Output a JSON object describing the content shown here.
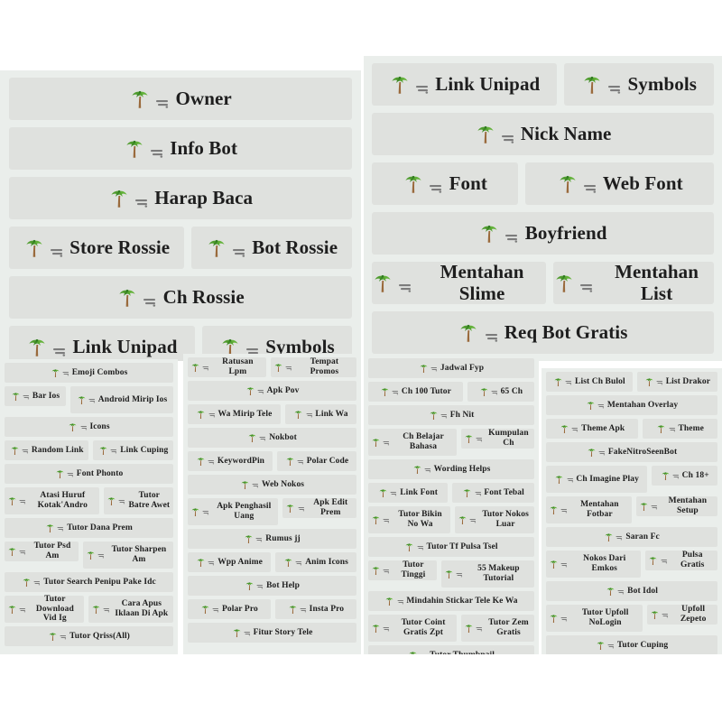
{
  "meta": {
    "icon_name": "palm-tree-icon",
    "panel_bg": "#eaeeeb",
    "button_bg": "#dfe1de",
    "text_color": "#1e1e1e",
    "page_bg": "#ffffff"
  },
  "panels": [
    {
      "id": "panel-top-left",
      "rows": [
        [
          "Owner"
        ],
        [
          "Info Bot"
        ],
        [
          "Harap Baca"
        ],
        [
          "Store Rossie",
          "Bot Rossie"
        ],
        [
          "Ch Rossie"
        ],
        [
          "Link Unipad",
          "Symbols"
        ]
      ]
    },
    {
      "id": "panel-top-right",
      "rows": [
        [
          "Link Unipad",
          "Symbols"
        ],
        [
          "Nick Name"
        ],
        [
          "Font",
          "Web Font"
        ],
        [
          "Boyfriend"
        ],
        [
          "Mentahan Slime",
          "Mentahan List"
        ],
        [
          "Req Bot Gratis"
        ]
      ]
    },
    {
      "id": "panel-bottom-1",
      "rows": [
        [
          "Emoji Combos"
        ],
        [
          "Bar Ios",
          "Android Mirip Ios"
        ],
        [
          "Icons"
        ],
        [
          "Random Link",
          "Link Cuping"
        ],
        [
          "Font Phonto"
        ],
        [
          "Atasi Huruf Kotak'Andro",
          "Tutor Batre Awet"
        ],
        [
          "Tutor Dana Prem"
        ],
        [
          "Tutor Psd Am",
          "Tutor Sharpen Am"
        ],
        [
          "Tutor Search Penipu Pake Idc"
        ],
        [
          "Tutor Download Vid Ig",
          "Cara Apus Iklaan Di Apk"
        ],
        [
          "Tutor Qriss(All)"
        ]
      ]
    },
    {
      "id": "panel-bottom-2",
      "rows": [
        [
          "Ratusan Lpm",
          "Tempat Promos"
        ],
        [
          "Apk Pov"
        ],
        [
          "Wa Mirip Tele",
          "Link Wa"
        ],
        [
          "Nokbot"
        ],
        [
          "KeywordPin",
          "Polar Code"
        ],
        [
          "Web Nokos"
        ],
        [
          "Apk Penghasil Uang",
          "Apk Edit Prem"
        ],
        [
          "Rumus jj"
        ],
        [
          "Wpp Anime",
          "Anim Icons"
        ],
        [
          "Bot Help"
        ],
        [
          "Polar Pro",
          "Insta Pro"
        ],
        [
          "Fitur Story Tele"
        ]
      ]
    },
    {
      "id": "panel-bottom-3",
      "rows": [
        [
          "Jadwal Fyp"
        ],
        [
          "Ch 100 Tutor",
          "65 Ch"
        ],
        [
          "Fh Nit"
        ],
        [
          "Ch Belajar Bahasa",
          "Kumpulan Ch"
        ],
        [
          "Wording Helps"
        ],
        [
          "Link Font",
          "Font Tebal"
        ],
        [
          "Tutor Bikin No Wa",
          "Tutor Nokos Luar"
        ],
        [
          "Tutor Tf Pulsa Tsel"
        ],
        [
          "Tutor Tinggi",
          "55 Makeup Tutorial"
        ],
        [
          "Mindahin Stickar Tele Ke Wa"
        ],
        [
          "Tutor Coint Gratis Zpt",
          "Tutor Zem Gratis"
        ],
        [
          "Tutor Thumbnail"
        ]
      ]
    },
    {
      "id": "panel-bottom-4",
      "rows": [
        [
          "List Ch Bulol",
          "List Drakor"
        ],
        [
          "Mentahan Overlay"
        ],
        [
          "Theme Apk",
          "Theme"
        ],
        [
          "FakeNitroSeenBot"
        ],
        [
          "Ch Imagine Play",
          "Ch 18+"
        ],
        [
          "Mentahan Fotbar",
          "Mentahan Setup"
        ],
        [
          "Saran Fc"
        ],
        [
          "Nokos Dari Emkos",
          "Pulsa Gratis"
        ],
        [
          "Bot Idol"
        ],
        [
          "Tutor Upfoll NoLogin",
          "Upfoll Zepeto"
        ],
        [
          "Tutor Cuping"
        ]
      ]
    }
  ]
}
